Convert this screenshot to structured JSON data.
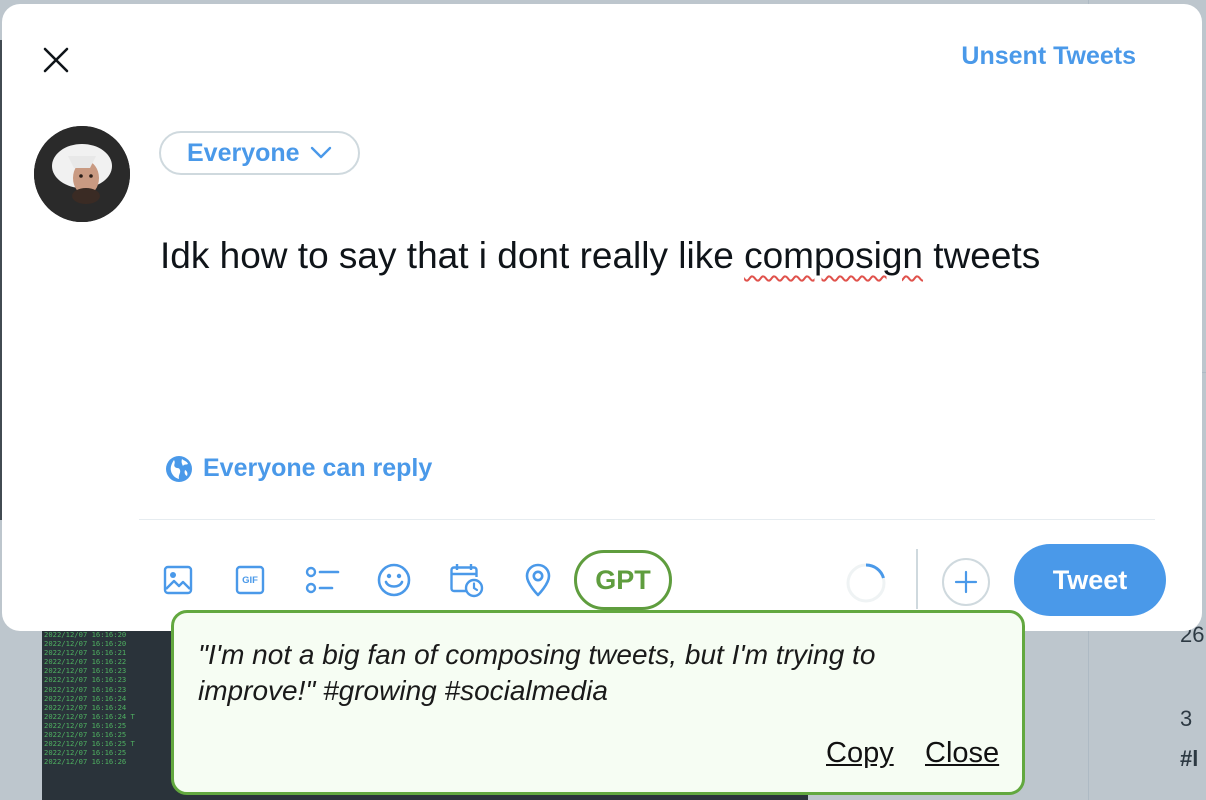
{
  "modal": {
    "close_icon": "close-icon",
    "unsent_tweets_label": "Unsent Tweets"
  },
  "composer": {
    "audience_label": "Everyone",
    "text_before": "Idk how to say that i dont really like ",
    "text_misspelled": "composign",
    "text_after": " tweets",
    "reply_setting_label": "Everyone can reply"
  },
  "toolbar": {
    "icons": [
      "image-icon",
      "gif-icon",
      "poll-icon",
      "emoji-icon",
      "schedule-icon",
      "location-icon"
    ],
    "gif_text": "GIF",
    "gpt_label": "GPT",
    "tweet_label": "Tweet"
  },
  "gpt_popup": {
    "suggestion": "\"I'm not a big fan of composing tweets, but I'm trying to improve!\" #growing #socialmedia",
    "copy_label": "Copy",
    "close_label": "Close"
  },
  "background": {
    "right_fragments": [
      "26",
      "3",
      "#l"
    ],
    "terminal_lines": [
      "2022/12/07 16:16:20",
      "2022/12/07 16:16:20",
      "2022/12/07 16:16:21",
      "2022/12/07 16:16:22",
      "2022/12/07 16:16:23",
      "2022/12/07 16:16:23",
      "2022/12/07 16:16:23",
      "2022/12/07 16:16:24",
      "2022/12/07 16:16:24",
      "2022/12/07 16:16:24 T",
      "2022/12/07 16:16:25",
      "2022/12/07 16:16:25",
      "2022/12/07 16:16:25 T",
      "2022/12/07 16:16:25",
      "2022/12/07 16:16:26"
    ]
  },
  "colors": {
    "accent": "#4a99e9",
    "gpt_green": "#5f9d3e",
    "popup_bg": "#f6fdf3",
    "spellcheck": "#e0524c"
  }
}
